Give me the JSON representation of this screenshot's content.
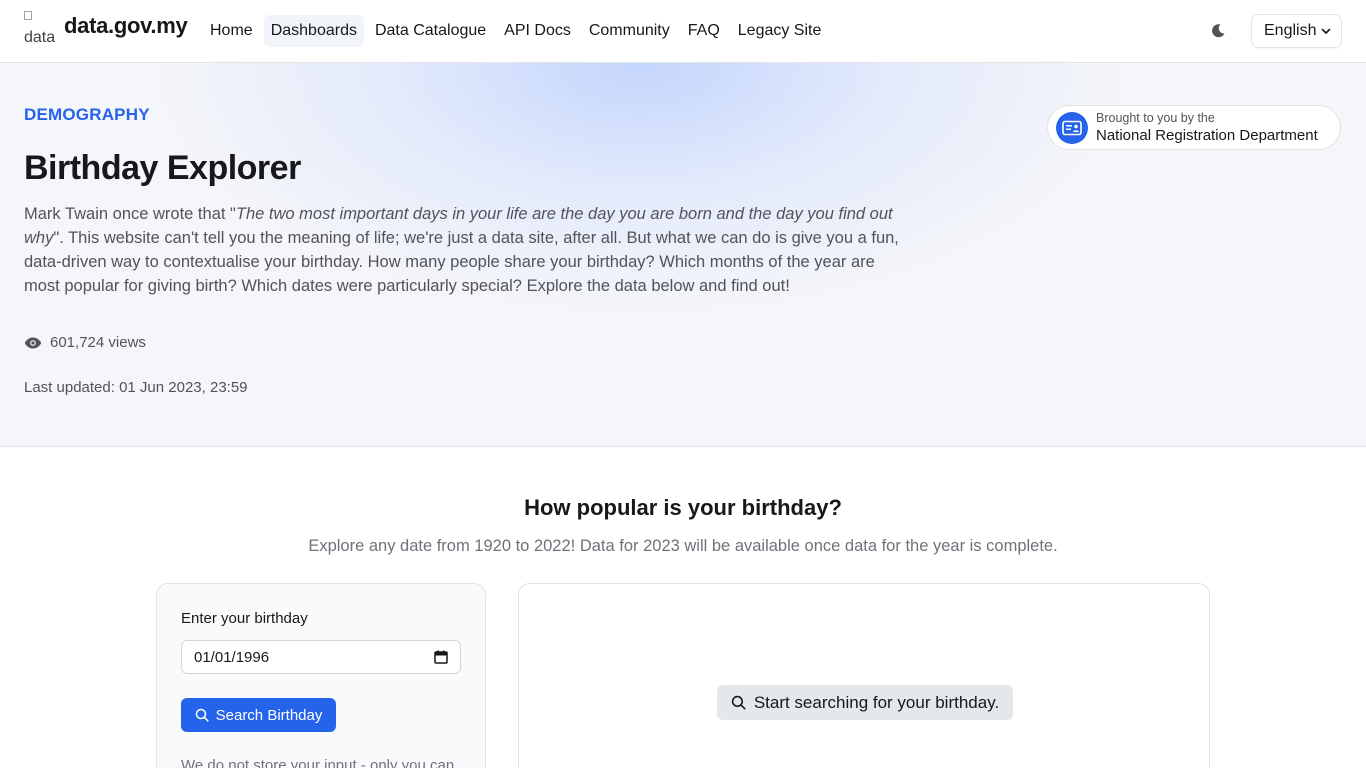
{
  "header": {
    "logo_alt": "data",
    "site_name": "data.gov.my",
    "nav": [
      {
        "label": "Home"
      },
      {
        "label": "Dashboards",
        "active": true
      },
      {
        "label": "Data Catalogue"
      },
      {
        "label": "API Docs"
      },
      {
        "label": "Community"
      },
      {
        "label": "FAQ"
      },
      {
        "label": "Legacy Site"
      }
    ],
    "theme_icon": "moon-icon",
    "language": "English"
  },
  "hero": {
    "category": "DEMOGRAPHY",
    "title": "Birthday Explorer",
    "desc_prefix": "Mark Twain once wrote that \"",
    "desc_quote": "The two most important days in your life are the day you are born and the day you find out why",
    "desc_suffix": "\". This website can't tell you the meaning of life; we're just a data site, after all. But what we can do is give you a fun, data-driven way to contextualise your birthday. How many people share your birthday? Which months of the year are most popular for giving birth? Which dates were particularly special? Explore the data below and find out!",
    "views": "601,724 views",
    "last_updated": "Last updated: 01 Jun 2023, 23:59",
    "agency": {
      "sub": "Brought to you by the",
      "name": "National Registration Department"
    }
  },
  "section": {
    "title": "How popular is your birthday?",
    "subtitle": "Explore any date from 1920 to 2022! Data for 2023 will be available once data for the year is complete."
  },
  "form": {
    "label": "Enter your birthday",
    "date_value": "01/01/1996",
    "search_label": "Search Birthday",
    "privacy_note": "We do not store your input - only you can"
  },
  "result": {
    "empty_state": "Start searching for your birthday."
  },
  "colors": {
    "accent": "#2563eb",
    "text": "#18181b",
    "muted": "#52525b"
  }
}
